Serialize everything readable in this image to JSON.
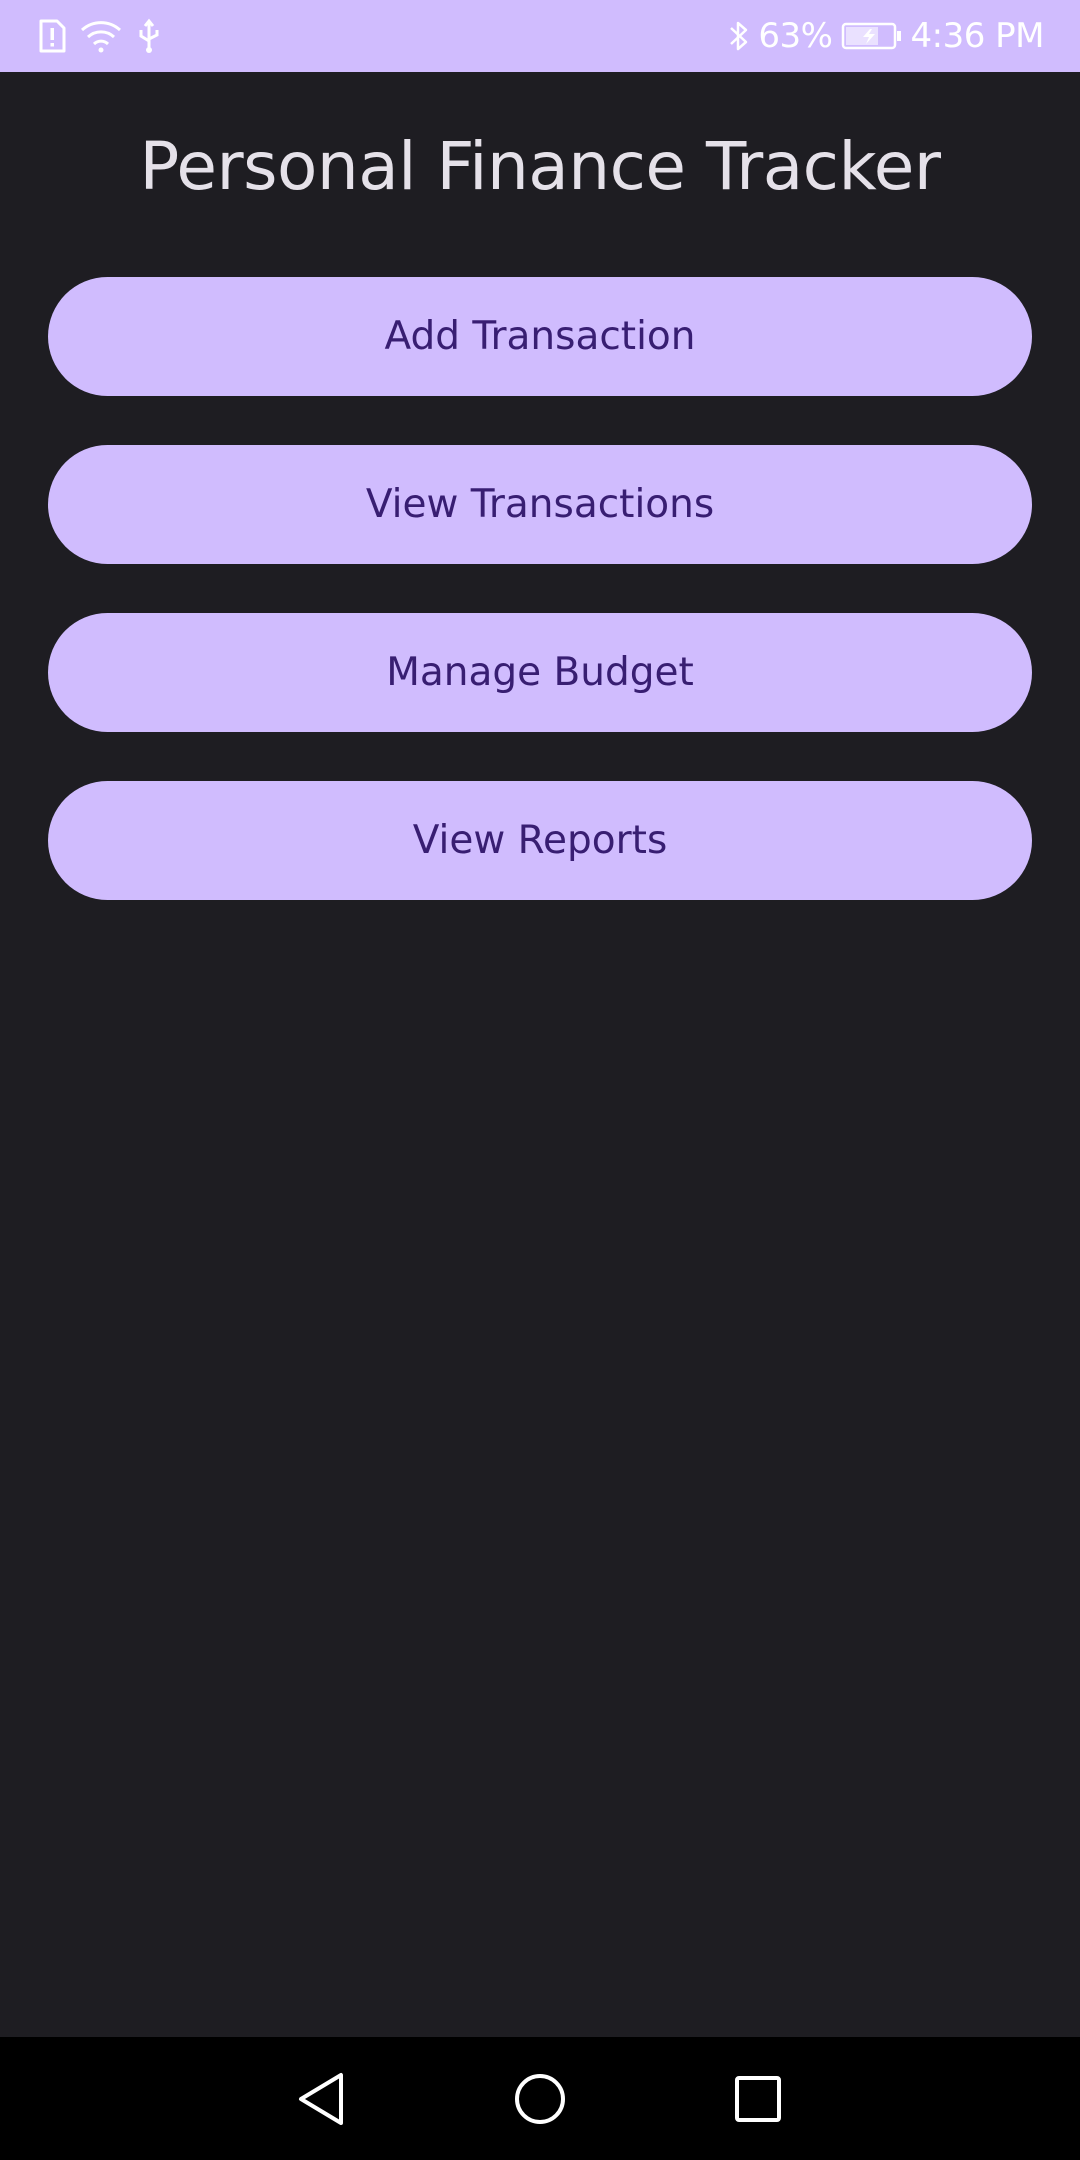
{
  "status_bar": {
    "battery_percent": "63%",
    "time": "4:36 PM",
    "left_icons": [
      "sim-alert-icon",
      "wifi-icon",
      "usb-icon"
    ],
    "right_icons": [
      "bluetooth-icon",
      "battery-charging-icon"
    ]
  },
  "app": {
    "title": "Personal Finance Tracker"
  },
  "menu": {
    "add_transaction": "Add Transaction",
    "view_transactions": "View Transactions",
    "manage_budget": "Manage Budget",
    "view_reports": "View Reports"
  },
  "nav_bar": {
    "icons": [
      "back-icon",
      "home-icon",
      "recents-icon"
    ]
  },
  "colors": {
    "primary": "#d0bcfe",
    "on_primary": "#381e72",
    "background": "#1e1d22",
    "title_text": "#e5e1e9",
    "nav_background": "#000000"
  }
}
